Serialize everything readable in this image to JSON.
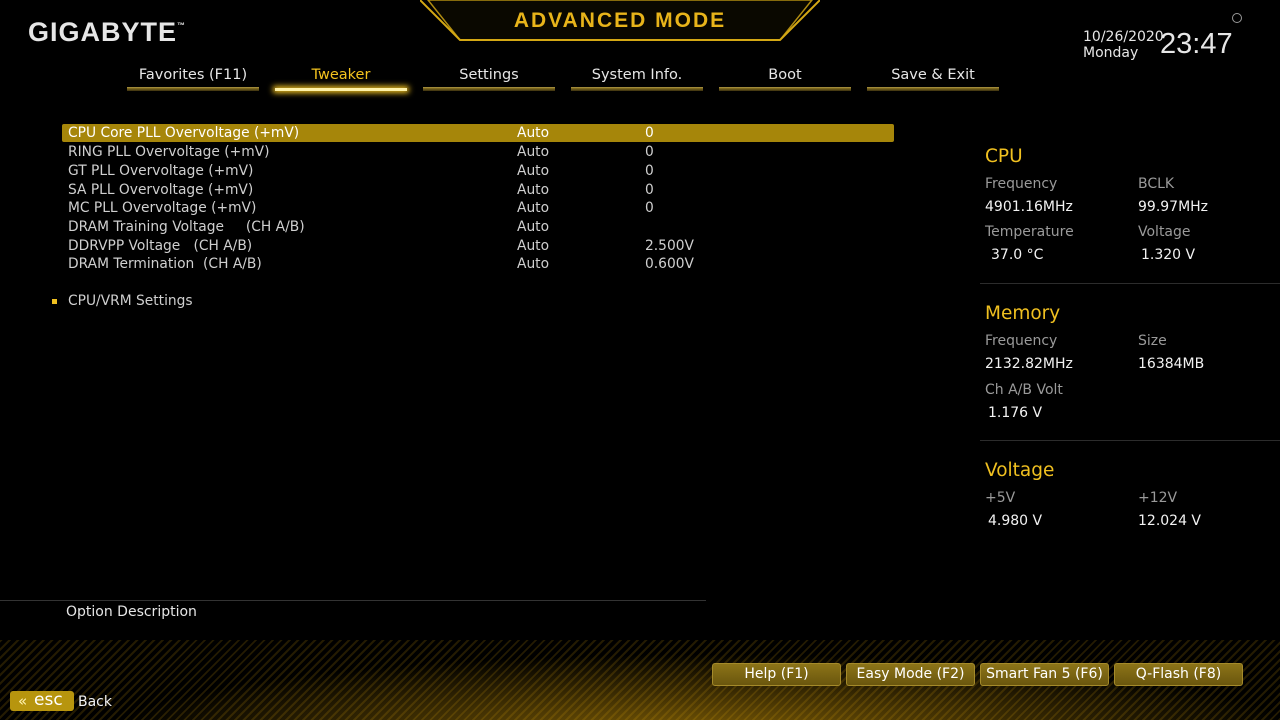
{
  "header": {
    "brand": "GIGABYTE",
    "brand_tm": "™",
    "mode_title": "ADVANCED MODE",
    "date": "10/26/2020",
    "weekday": "Monday",
    "time": "23:47",
    "accent_color": "#f0c020"
  },
  "tabs": [
    {
      "label": "Favorites (F11)",
      "active": false
    },
    {
      "label": "Tweaker",
      "active": true
    },
    {
      "label": "Settings",
      "active": false
    },
    {
      "label": "System Info.",
      "active": false
    },
    {
      "label": "Boot",
      "active": false
    },
    {
      "label": "Save & Exit",
      "active": false
    }
  ],
  "settings": [
    {
      "label": "CPU Core PLL Overvoltage (+mV)",
      "mode": "Auto",
      "value": "0",
      "selected": true
    },
    {
      "label": "RING PLL Overvoltage (+mV)",
      "mode": "Auto",
      "value": "0"
    },
    {
      "label": "GT PLL Overvoltage (+mV)",
      "mode": "Auto",
      "value": "0"
    },
    {
      "label": "SA PLL Overvoltage (+mV)",
      "mode": "Auto",
      "value": "0"
    },
    {
      "label": "MC PLL Overvoltage (+mV)",
      "mode": "Auto",
      "value": "0"
    },
    {
      "label": "DRAM Training Voltage     (CH A/B)",
      "mode": "Auto",
      "value": ""
    },
    {
      "label": "DDRVPP Voltage   (CH A/B)",
      "mode": "Auto",
      "value": "2.500V"
    },
    {
      "label": "DRAM Termination  (CH A/B)",
      "mode": "Auto",
      "value": "0.600V"
    }
  ],
  "submenu": {
    "label": "CPU/VRM Settings"
  },
  "description": {
    "title": "Option Description"
  },
  "info_panel": {
    "cpu": {
      "title": "CPU",
      "freq_label": "Frequency",
      "freq_value": "4901.16MHz",
      "bclk_label": "BCLK",
      "bclk_value": "99.97MHz",
      "temp_label": "Temperature",
      "temp_value": "37.0 °C",
      "volt_label": "Voltage",
      "volt_value": "1.320 V"
    },
    "memory": {
      "title": "Memory",
      "freq_label": "Frequency",
      "freq_value": "2132.82MHz",
      "size_label": "Size",
      "size_value": "16384MB",
      "chvolt_label": "Ch A/B Volt",
      "chvolt_value": "1.176 V"
    },
    "voltage": {
      "title": "Voltage",
      "v5_label": "+5V",
      "v5_value": "4.980 V",
      "v12_label": "+12V",
      "v12_value": "12.024 V"
    }
  },
  "footer": {
    "buttons": [
      "Help (F1)",
      "Easy Mode (F2)",
      "Smart Fan 5 (F6)",
      "Q-Flash (F8)"
    ],
    "esc_label": "esc",
    "back_label": "Back"
  }
}
